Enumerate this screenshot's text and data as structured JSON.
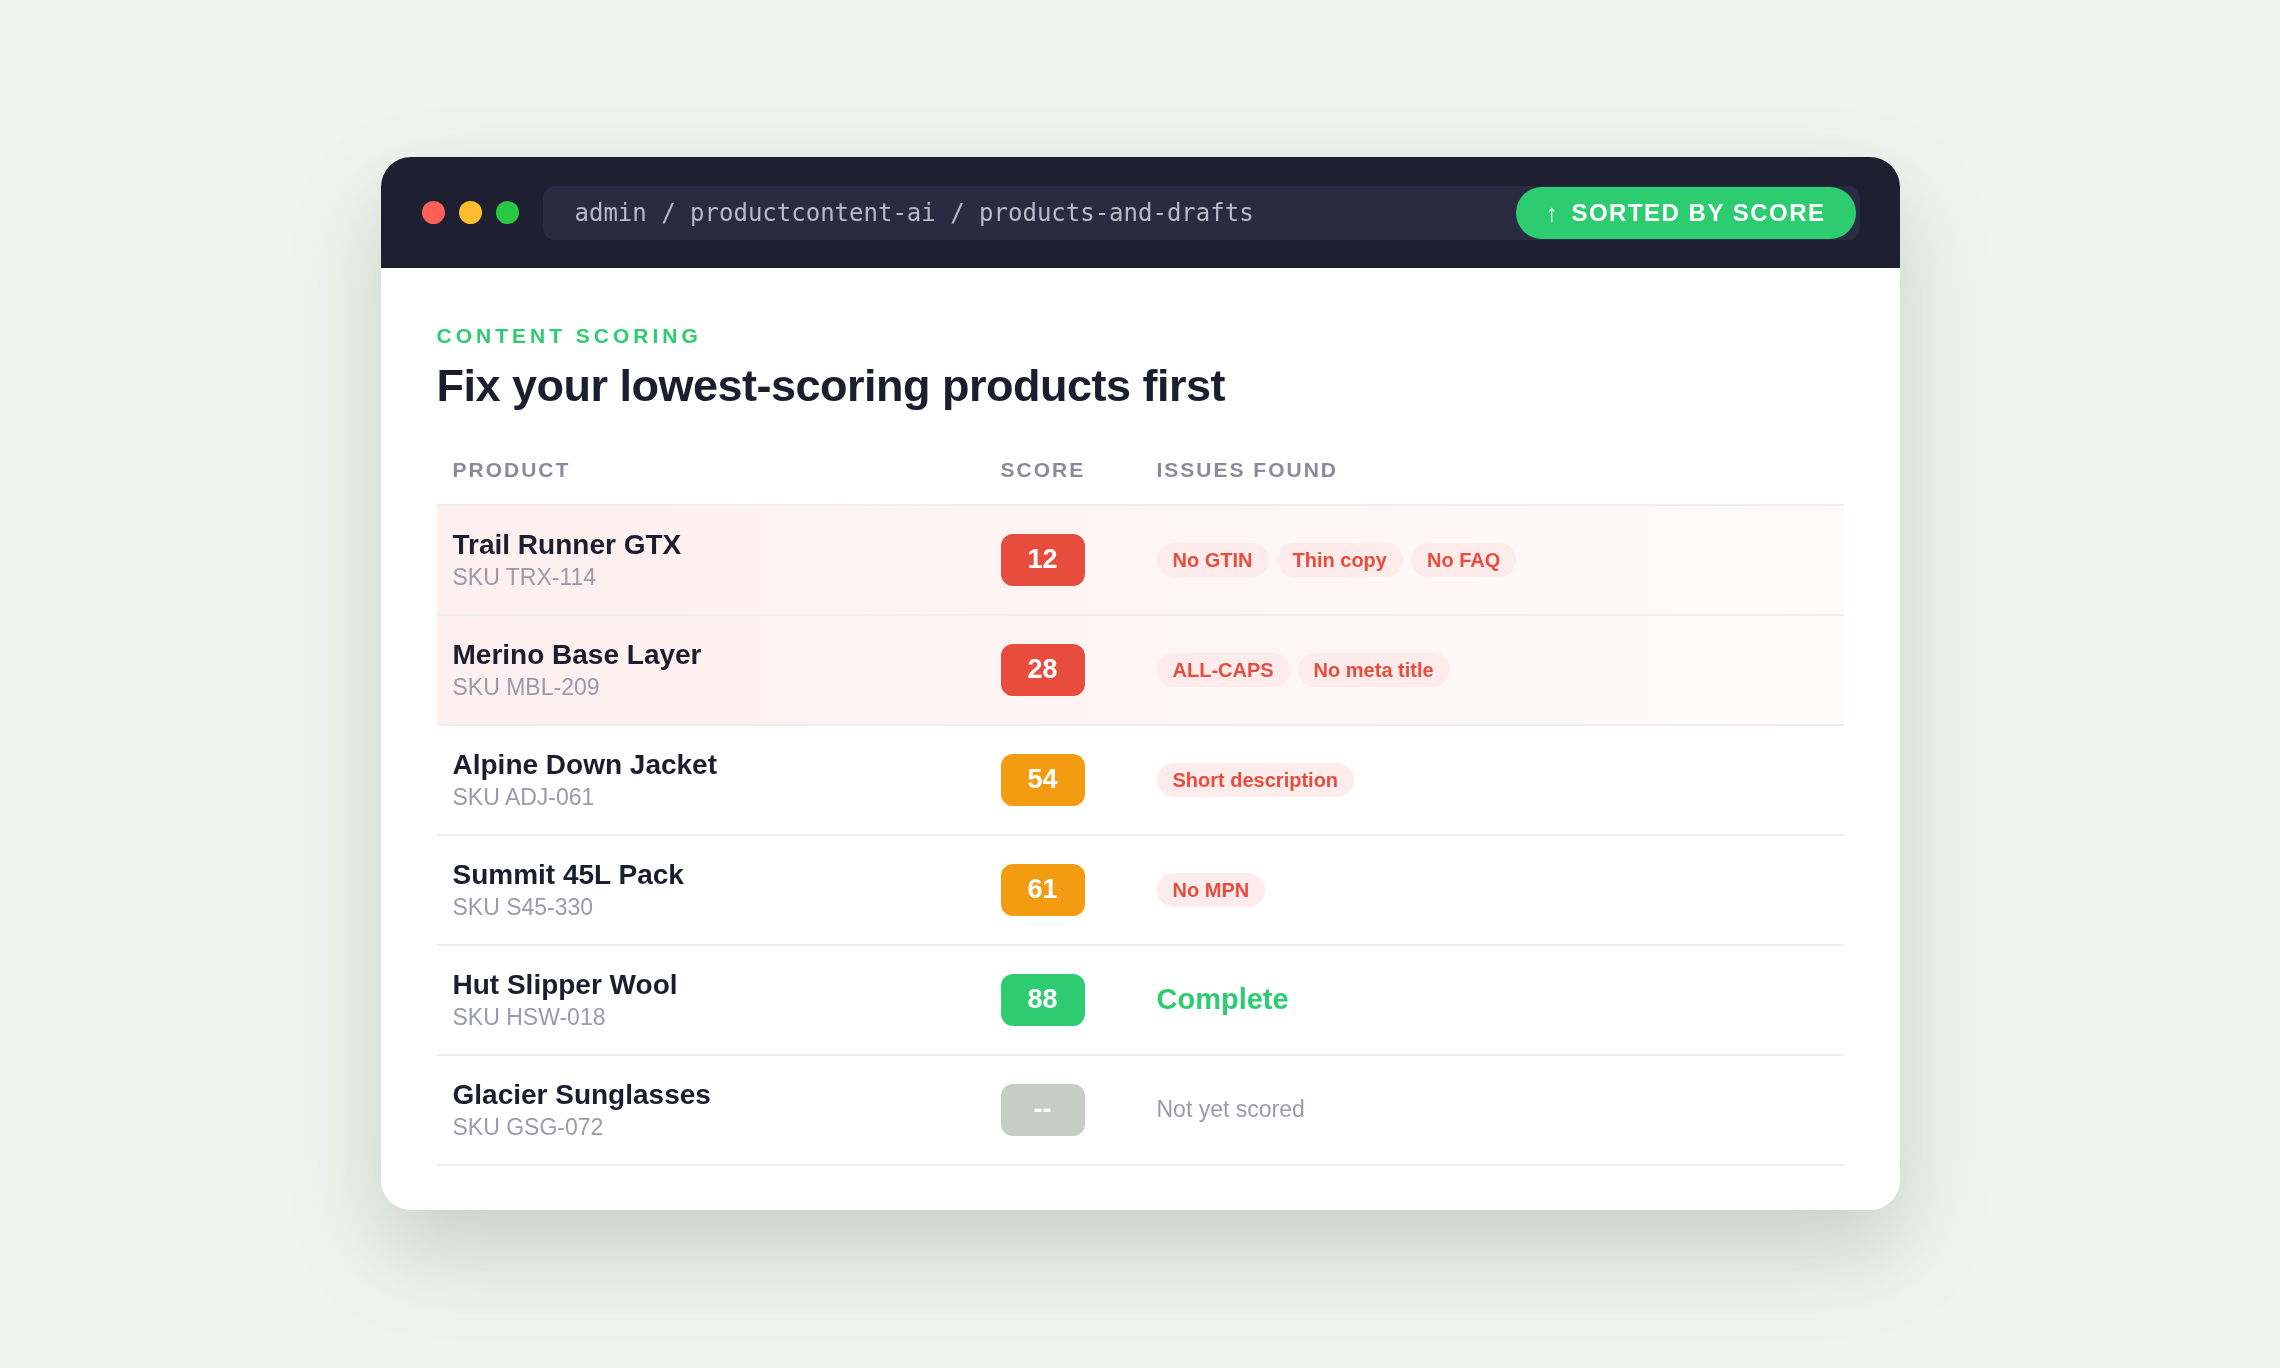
{
  "window": {
    "path": "admin / productcontent-ai / products-and-drafts",
    "sort_badge": {
      "icon": "↑",
      "label": "SORTED BY SCORE"
    }
  },
  "kicker": "CONTENT SCORING",
  "heading": "Fix your lowest-scoring products first",
  "table": {
    "columns": [
      "PRODUCT",
      "SCORE",
      "ISSUES FOUND"
    ],
    "rows": [
      {
        "name": "Trail Runner GTX",
        "sku": "SKU TRX-114",
        "score": "12",
        "kind": "low",
        "issues": [
          "No GTIN",
          "Thin copy",
          "No FAQ"
        ]
      },
      {
        "name": "Merino Base Layer",
        "sku": "SKU MBL-209",
        "score": "28",
        "kind": "low",
        "issues": [
          "ALL-CAPS",
          "No meta title"
        ]
      },
      {
        "name": "Alpine Down Jacket",
        "sku": "SKU ADJ-061",
        "score": "54",
        "kind": "mid",
        "issues": [
          "Short description"
        ]
      },
      {
        "name": "Summit 45L Pack",
        "sku": "SKU S45-330",
        "score": "61",
        "kind": "mid",
        "issues": [
          "No MPN"
        ]
      },
      {
        "name": "Hut Slipper Wool",
        "sku": "SKU HSW-018",
        "score": "88",
        "kind": "high",
        "status": "Complete"
      },
      {
        "name": "Glacier Sunglasses",
        "sku": "SKU GSG-072",
        "score": "--",
        "kind": "none",
        "status": "Not yet scored"
      }
    ]
  }
}
